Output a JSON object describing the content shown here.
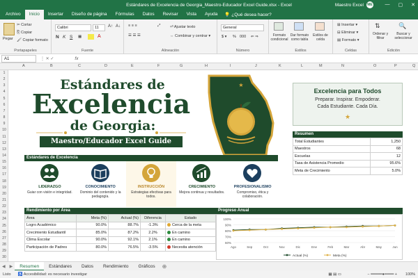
{
  "window": {
    "title": "Estándares de Excelencia de Georgia_Maestro-Educador Excel Guide.xlsx - Excel",
    "user_name": "Maestro Excel",
    "user_initials": "ME"
  },
  "menu": {
    "tabs": [
      "Archivo",
      "Inicio",
      "Insertar",
      "Diseño de página",
      "Fórmulas",
      "Datos",
      "Revisar",
      "Vista",
      "Ayuda"
    ],
    "active": "Inicio",
    "tell_me": "¿Qué desea hacer?"
  },
  "ribbon": {
    "paste": "Pegar",
    "cut": "Cortar",
    "copy": "Copiar",
    "format_painter": "Copiar formato",
    "clipboard_label": "Portapapeles",
    "font_name": "Calibri",
    "font_size": "11",
    "font_label": "Fuente",
    "wrap_text": "Ajustar texto",
    "merge_center": "Combinar y centrar",
    "alignment_label": "Alineación",
    "number_format": "General",
    "number_label": "Número",
    "cond_format": "Formato condicional",
    "format_table": "Dar formato como tabla",
    "cell_styles": "Estilos de celda",
    "styles_label": "Estilos",
    "insert": "Insertar",
    "delete": "Eliminar",
    "format": "Formato",
    "cells_label": "Celdas",
    "sort_filter": "Ordenar y filtrar",
    "find_select": "Buscar y seleccionar",
    "editing_label": "Edición",
    "bold": "N",
    "italic": "K",
    "underline": "S",
    "percent": "%",
    "thousands": "000"
  },
  "formula_bar": {
    "name_box": "A1",
    "fx": "fx"
  },
  "columns": [
    "A",
    "B",
    "C",
    "D",
    "E",
    "F",
    "G",
    "H",
    "I",
    "J",
    "K",
    "L",
    "M",
    "N",
    "O",
    "P",
    "Q"
  ],
  "rows": [
    "1",
    "2",
    "3",
    "4",
    "5",
    "6",
    "7",
    "8",
    "9",
    "10",
    "11",
    "12",
    "13",
    "14",
    "15",
    "16",
    "17",
    "18",
    "19",
    "20",
    "21",
    "22",
    "23",
    "24",
    "25",
    "26",
    "27",
    "28",
    "29",
    "30"
  ],
  "hero": {
    "line1": "Estándares de",
    "line2": "Excelencia",
    "line3": "de Georgia:",
    "banner": "Maestro/Educador Excel Guide"
  },
  "excellence_box": {
    "title": "Excelencia para Todos",
    "line1": "Preparar. Inspirar. Empoderar.",
    "line2": "Cada Estudiante. Cada Día."
  },
  "summary": {
    "title": "Resumen",
    "rows": [
      {
        "label": "Total Estudiantes",
        "value": "1,250"
      },
      {
        "label": "Maestros",
        "value": "68"
      },
      {
        "label": "Escuelas",
        "value": "12"
      },
      {
        "label": "Tasa de Asistencia Promedio",
        "value": "95.6%"
      },
      {
        "label": "Meta de Crecimiento",
        "value": "5.0%"
      }
    ]
  },
  "standards": {
    "title": "Estándares de Excelencia",
    "pillars": [
      {
        "name": "LIDERAZGO",
        "desc": "Guiar con visión e integridad.",
        "icon": "people-icon",
        "color": "#1f4b2c"
      },
      {
        "name": "CONOCIMIENTO",
        "desc": "Dominio del contenido y la pedagogía.",
        "icon": "book-icon",
        "color": "#1c3f5e"
      },
      {
        "name": "INSTRUCCIÓN",
        "desc": "Estrategias efectivas para todos.",
        "icon": "lightbulb-icon",
        "color": "#d4a53a"
      },
      {
        "name": "CRECIMIENTO",
        "desc": "Mejora continua y resultados.",
        "icon": "growth-chart-icon",
        "color": "#1f4b2c"
      },
      {
        "name": "PROFESIONALISMO",
        "desc": "Compromiso, ética y colaboración.",
        "icon": "heart-icon",
        "color": "#1c3f5e"
      }
    ]
  },
  "performance": {
    "title": "Rendimiento por Área",
    "headers": [
      "Área",
      "Meta (%)",
      "Actual (%)",
      "Diferencia",
      "Estado"
    ],
    "rows": [
      {
        "area": "Logro Académico",
        "meta": "90.0%",
        "actual": "88.7%",
        "diff": "-1.3%",
        "status": "Cerca de la meta",
        "status_color": "#e0a830"
      },
      {
        "area": "Crecimiento Estudiantil",
        "meta": "85.0%",
        "actual": "87.2%",
        "diff": "2.2%",
        "status": "En camino",
        "status_color": "#2e8b3e"
      },
      {
        "area": "Clima Escolar",
        "meta": "90.0%",
        "actual": "92.1%",
        "diff": "2.1%",
        "status": "En camino",
        "status_color": "#2e8b3e"
      },
      {
        "area": "Participación de Padres",
        "meta": "80.0%",
        "actual": "76.5%",
        "diff": "-3.5%",
        "status": "Necesita atención",
        "status_color": "#d23a2a"
      }
    ]
  },
  "progress_chart": {
    "title": "Progreso Anual"
  },
  "chart_data": {
    "type": "line",
    "categories": [
      "Ago",
      "Sep",
      "Oct",
      "Nov",
      "Dic",
      "Ene",
      "Feb",
      "Mar",
      "Abr",
      "May",
      "Jun"
    ],
    "series": [
      {
        "name": "Actual (%)",
        "values": [
          81,
          82,
          82,
          84,
          85,
          86,
          86,
          87,
          88,
          88,
          89
        ],
        "color": "#1f4b2c"
      },
      {
        "name": "Meta (%)",
        "values": [
          80,
          81,
          82,
          83,
          84,
          85,
          86,
          86,
          87,
          88,
          89
        ],
        "color": "#e0b34a"
      }
    ],
    "yticks": [
      "100%",
      "90%",
      "80%",
      "70%",
      "60%"
    ],
    "ylim": [
      60,
      100
    ]
  },
  "sheet_tabs": [
    "Resumen",
    "Estándares",
    "Datos",
    "Rendimiento",
    "Gráficos"
  ],
  "active_sheet": "Resumen",
  "status_bar": {
    "ready": "Listo",
    "accessibility": "Accesibilidad: es necesario investigar",
    "zoom": "100%"
  }
}
